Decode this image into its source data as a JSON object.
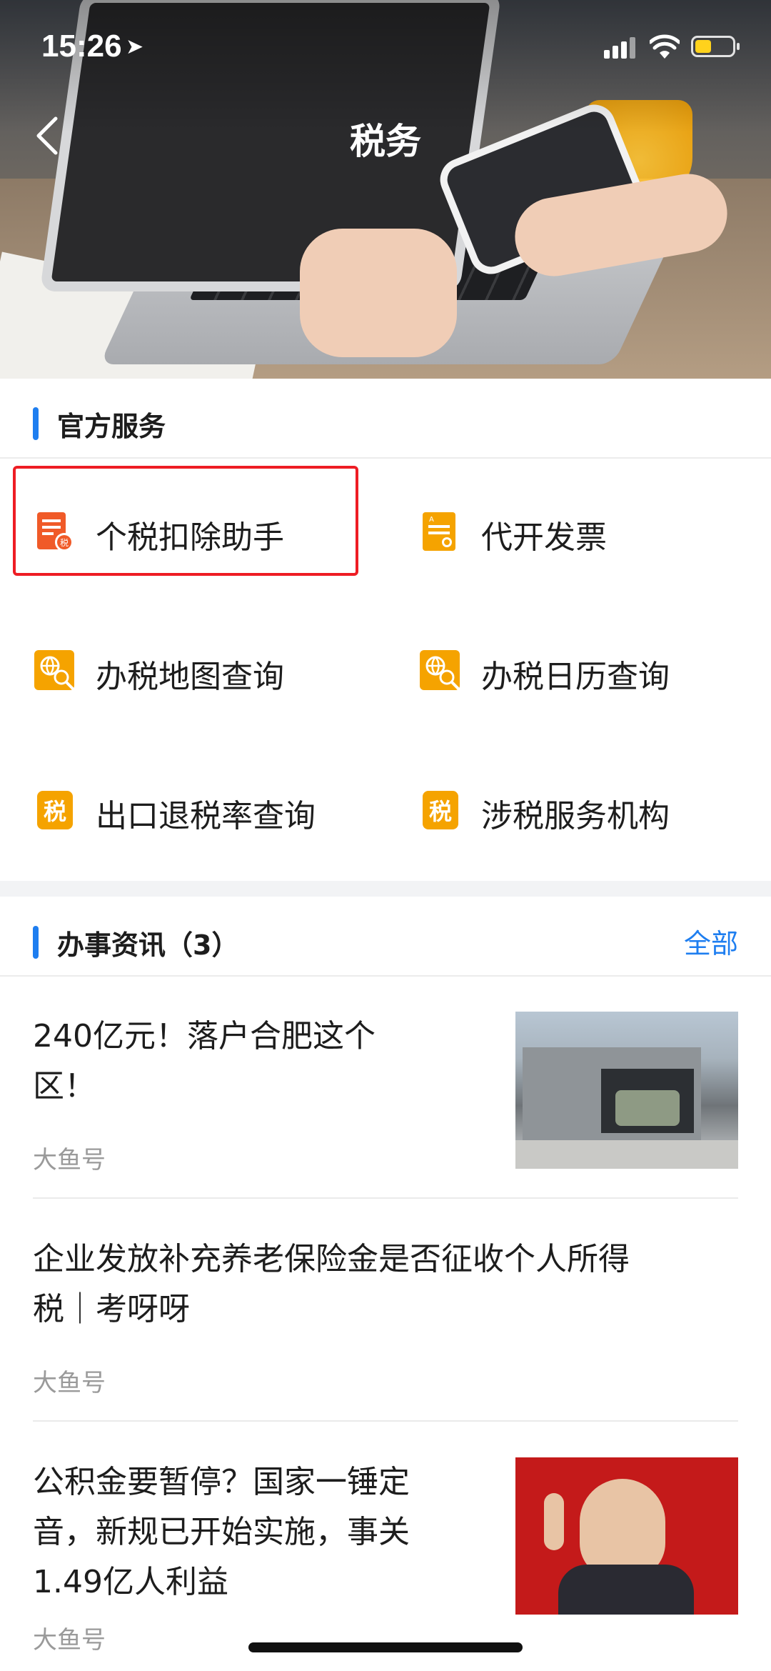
{
  "status_bar": {
    "time": "15:26"
  },
  "nav": {
    "title": "税务"
  },
  "official": {
    "heading": "官方服务",
    "items": [
      {
        "label": "个税扣除助手",
        "icon": "tax-doc-icon"
      },
      {
        "label": "代开发票",
        "icon": "invoice-icon"
      },
      {
        "label": "办税地图查询",
        "icon": "globe-search-icon"
      },
      {
        "label": "办税日历查询",
        "icon": "globe-search-icon"
      },
      {
        "label": "出口退税率查询",
        "icon": "tax-emblem-icon"
      },
      {
        "label": "涉税服务机构",
        "icon": "tax-emblem-icon"
      }
    ]
  },
  "news": {
    "heading": "办事资讯（3）",
    "all_label": "全部",
    "items": [
      {
        "title_line1": "240亿元！落户合肥这个",
        "title_line2": "区！",
        "source": "大鱼号"
      },
      {
        "title_line1": "企业发放补充养老保险金是否征收个人所得",
        "title_line2": "税｜考呀呀",
        "source": "大鱼号"
      },
      {
        "title_line1": "公积金要暂停？国家一锤定",
        "title_line2": "音，新规已开始实施，事关",
        "title_line3": "1.49亿人利益",
        "source": "大鱼号"
      }
    ]
  },
  "colors": {
    "accent": "#1e7ef0",
    "icon_orange": "#f5a300",
    "icon_red": "#f05a28",
    "highlight": "#ee1d24"
  }
}
